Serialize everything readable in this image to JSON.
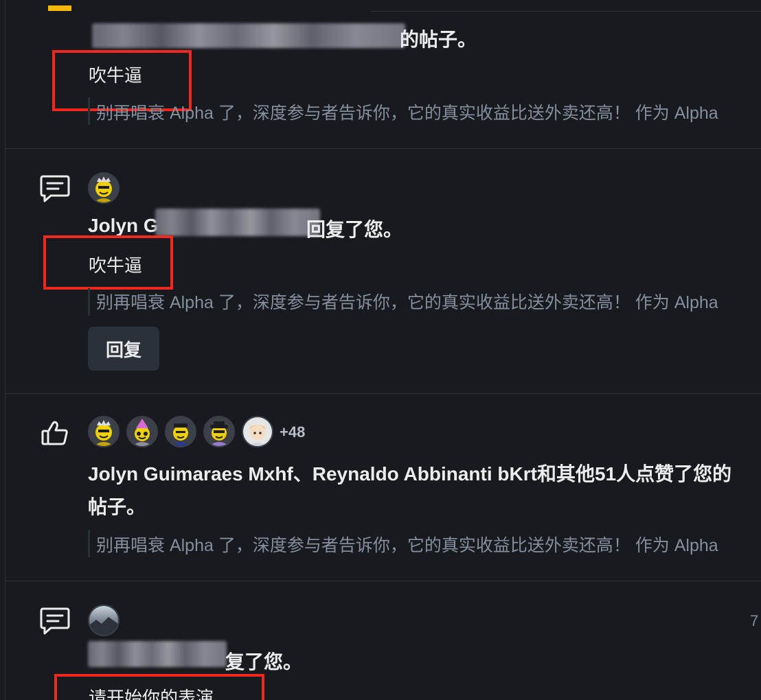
{
  "notifications": [
    {
      "type": "partial",
      "title_suffix": "的帖子。",
      "comment": "吹牛逼",
      "quote": "别再唱衰 Alpha 了，深度参与者告诉你，它的真实收益比送外卖还高！ 作为 Alpha"
    },
    {
      "type": "reply",
      "actor_visible": "Jolyn G",
      "title_suffix": "回复了您。",
      "comment": "吹牛逼",
      "quote": "别再唱衰 Alpha 了，深度参与者告诉你，它的真实收益比送外卖还高！ 作为 Alpha",
      "reply_label": "回复"
    },
    {
      "type": "like",
      "more_count": "+48",
      "title_line1": "Jolyn Guimaraes Mxhf、Reynaldo Abbinanti bKrt和其他51人点赞了您的",
      "title_line2": "帖子。",
      "quote": "别再唱衰 Alpha 了，深度参与者告诉你，它的真实收益比送外卖还高！ 作为 Alpha"
    },
    {
      "type": "reply",
      "title_suffix": "复了您。",
      "comment": "请开始你的表演...",
      "time": "7"
    }
  ],
  "icons": {
    "comment": "comment-icon",
    "like": "thumbs-up-icon"
  },
  "colors": {
    "background": "#181a20",
    "divider": "#2b3139",
    "text_primary": "#eaecef",
    "text_secondary": "#848e9c",
    "highlight_box": "#f0281e",
    "brand_yellow": "#f0b90b"
  }
}
